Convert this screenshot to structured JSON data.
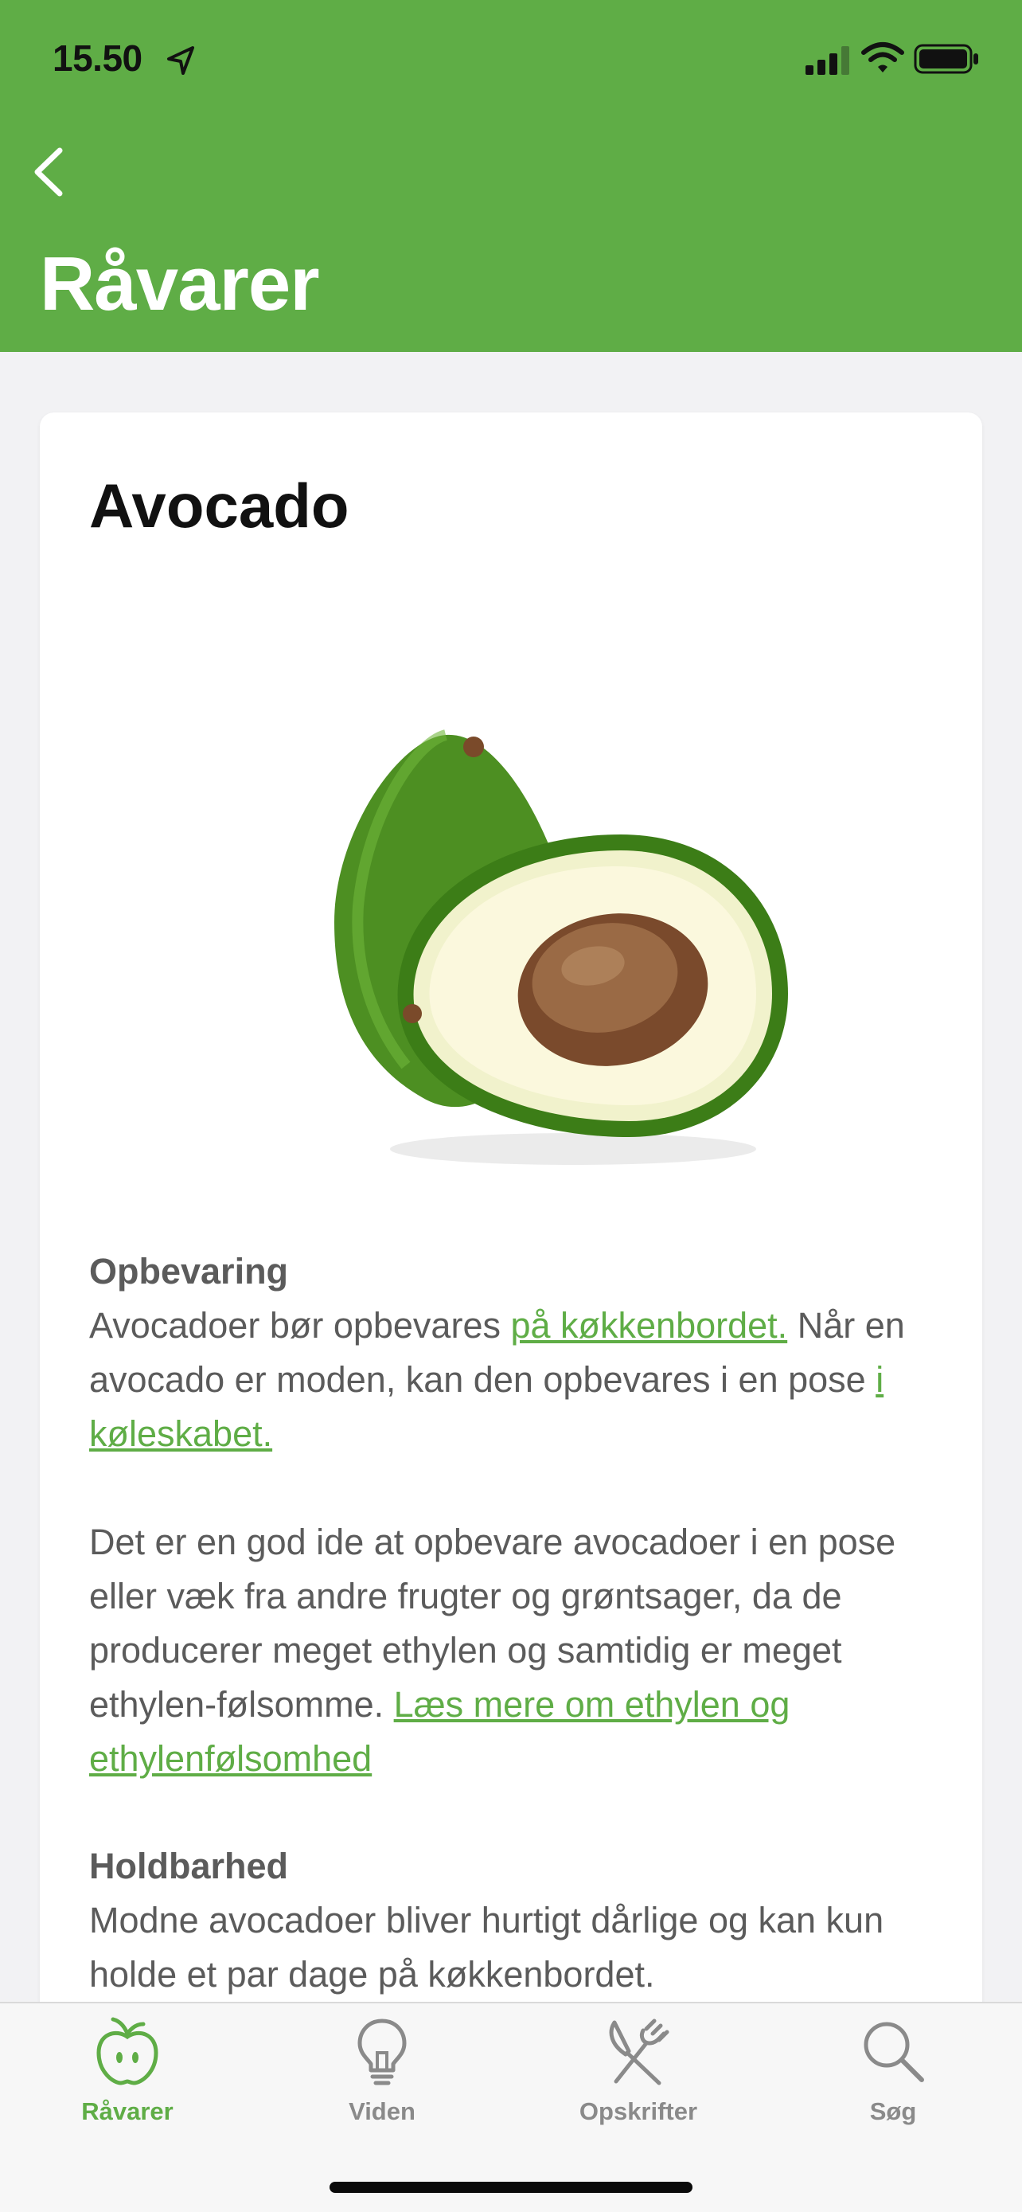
{
  "status_bar": {
    "time": "15.50",
    "icons": [
      "location-arrow-icon",
      "signal-icon",
      "wifi-icon",
      "battery-icon"
    ]
  },
  "header": {
    "back_icon": "chevron-left-icon",
    "title": "Råvarer"
  },
  "card": {
    "title": "Avocado",
    "image": "avocado-image",
    "storage": {
      "heading": "Opbevaring",
      "text_1": "Avocadoer bør opbevares ",
      "link_1": "på køkkenbordet.",
      "text_2": "Når en avocado er moden, kan den opbevares i en pose ",
      "link_2": "i køleskabet."
    },
    "ethylene": {
      "text": "Det er en god ide at opbevare avocadoer i en pose eller væk fra andre frugter og grøntsager, da de producerer meget ethylen og samtidig er meget ethylen-følsomme. ",
      "link": "Læs mere om ethylen og ethylenfølsomhed"
    },
    "shelf_life": {
      "heading": "Holdbarhed",
      "text": "Modne avocadoer bliver hurtigt dårlige og kan kun holde et par dage på køkkenbordet."
    }
  },
  "tabbar": {
    "tabs": [
      {
        "label": "Råvarer",
        "icon": "apple-icon",
        "active": true
      },
      {
        "label": "Viden",
        "icon": "lightbulb-icon",
        "active": false
      },
      {
        "label": "Opskrifter",
        "icon": "fork-knife-icon",
        "active": false
      },
      {
        "label": "Søg",
        "icon": "search-icon",
        "active": false
      }
    ]
  },
  "colors": {
    "brand_green": "#5fad46",
    "text_gray": "#5b5b5b",
    "tab_inactive": "#8a8a8a"
  }
}
